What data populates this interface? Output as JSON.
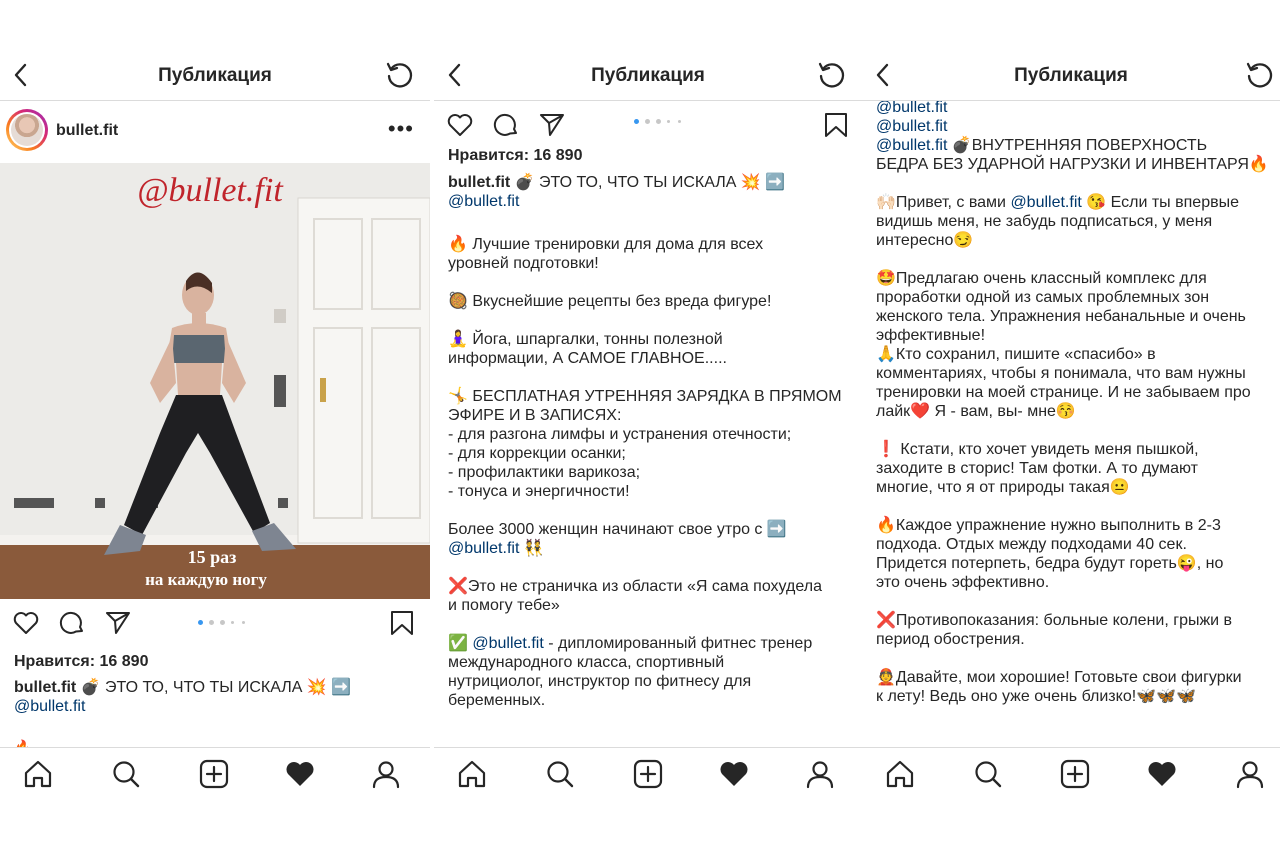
{
  "topbar": {
    "title": "Публикация"
  },
  "post": {
    "username": "bullet.fit",
    "likes": "Нравится: 16 890",
    "watermark": "@bullet.fit",
    "overlay_line1": "15 раз",
    "overlay_line2": "на каждую ногу",
    "caption_head": "💣 ЭТО ТО, ЧТО ТЫ ИСКАЛА 💥 ➡️",
    "caption_mention": "@bullet.fit"
  },
  "panel2": {
    "lines": [
      "🔥 Лучшие тренировки для дома для всех",
      "уровней подготовки!",
      "",
      "🥘 Вкуснейшие рецепты без вреда фигуре!",
      "",
      "🧘‍♀️ Йога, шпаргалки, тонны полезной",
      "информации, А САМОЕ ГЛАВНОЕ.....",
      "",
      "🤸 БЕСПЛАТНАЯ УТРЕННЯЯ ЗАРЯДКА В ПРЯМОМ",
      "ЭФИРЕ И В ЗАПИСЯХ:",
      "- для разгона лимфы и устранения отечности;",
      "- для коррекции осанки;",
      "- профилактики варикоза;",
      "- тонуса и энергичности!",
      "",
      "Более 3000 женщин начинают свое утро с ➡️",
      "@bullet.fit 👯",
      "",
      "❌Это не страничка из области «Я сама похудела",
      "и помогу тебе»",
      "",
      "✅ @bullet.fit - дипломированный фитнес тренер",
      "международного класса, спортивный",
      "нутрициолог, инструктор по фитнесу для",
      "беременных."
    ]
  },
  "panel3": {
    "lines": [
      "@bullet.fit",
      "@bullet.fit",
      "@bullet.fit    💣ВНУТРЕННЯЯ ПОВЕРХНОСТЬ",
      "БЕДРА БЕЗ УДАРНОЙ НАГРУЗКИ И ИНВЕНТАРЯ🔥",
      "",
      "🙌🏻Привет, с вами @bullet.fit 😘 Если ты впервые",
      "видишь меня, не забудь подписаться, у меня",
      "интересно😏",
      "",
      "🤩Предлагаю очень классный комплекс для",
      "проработки одной из самых проблемных зон",
      "женского тела. Упражнения небанальные и очень",
      "эффективные!",
      "🙏Кто сохранил, пишите «спасибо» в",
      "комментариях, чтобы я понимала, что вам нужны",
      "тренировки на моей странице. И не забываем про",
      "лайк❤️ Я - вам, вы- мне😚",
      "",
      "❗ Кстати, кто хочет увидеть меня пышкой,",
      "заходите в сторис! Там фотки. А то думают",
      "многие, что я от природы такая😐",
      "",
      "🔥Каждое упражнение нужно выполнить в 2-3",
      "подхода. Отдых между подходами 40 сек.",
      "Придется потерпеть, бедра будут гореть😜, но",
      "это очень эффективно.",
      "",
      "❌Противопоказания: больные колени, грыжи в",
      "период обострения.",
      "",
      "👲Давайте, мои хорошие! Готовьте свои фигурки",
      "к лету! Ведь оно уже очень близко!🦋🦋🦋"
    ]
  },
  "icons": {
    "back": "chevron-left-icon",
    "refresh": "refresh-icon",
    "more": "more-icon",
    "like": "heart-icon",
    "comment": "comment-icon",
    "share": "send-icon",
    "save": "bookmark-icon",
    "home": "home-icon",
    "search": "search-icon",
    "add": "add-icon",
    "activity": "heart-filled-icon",
    "profile": "profile-icon"
  },
  "colors": {
    "mention": "#00376b",
    "active_dot": "#3897f0",
    "watermark": "#c0242b",
    "text": "#262626"
  }
}
